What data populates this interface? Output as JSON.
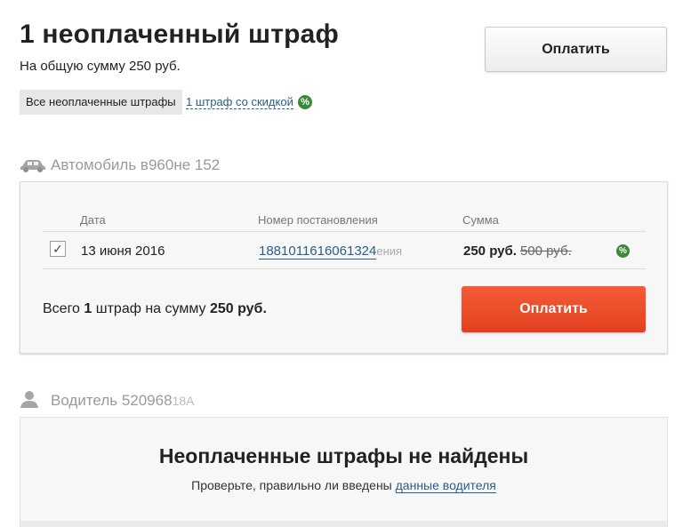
{
  "header": {
    "title": "1 неоплаченный штраф",
    "subtitle": "На общую сумму 250 руб.",
    "pay_button": "Оплатить"
  },
  "filters": {
    "active": "Все неоплаченные штрафы",
    "discount_link": "1 штраф со скидкой",
    "discount_icon": "%"
  },
  "car_section": {
    "icon": "car-icon",
    "title": "Автомобиль в960не 152",
    "table": {
      "headers": [
        "Дата",
        "Номер постановления",
        "Сумма"
      ],
      "rows": [
        {
          "checked": true,
          "checkmark": "✓",
          "date": "13 июня 2016",
          "resolution": "1881011616061324",
          "resolution_tail": "ения",
          "amount": "250 руб.",
          "old_amount": "500 руб.",
          "discount_icon": "%"
        }
      ]
    },
    "total": {
      "prefix": "Всего ",
      "count": "1",
      "middle": " штраф на сумму ",
      "sum": "250 руб."
    },
    "pay_button": "Оплатить"
  },
  "driver_section": {
    "icon": "person-icon",
    "title": "Водитель 520968",
    "title_tail": "18А",
    "empty_title": "Неоплаченные штрафы не найдены",
    "empty_text": "Проверьте, правильно ли введены ",
    "empty_link": "данные водителя"
  },
  "colors": {
    "accent_red": "#e84a25",
    "link": "#2a5d87",
    "discount_green": "#3b8a3b",
    "muted": "#9a9a9a"
  }
}
